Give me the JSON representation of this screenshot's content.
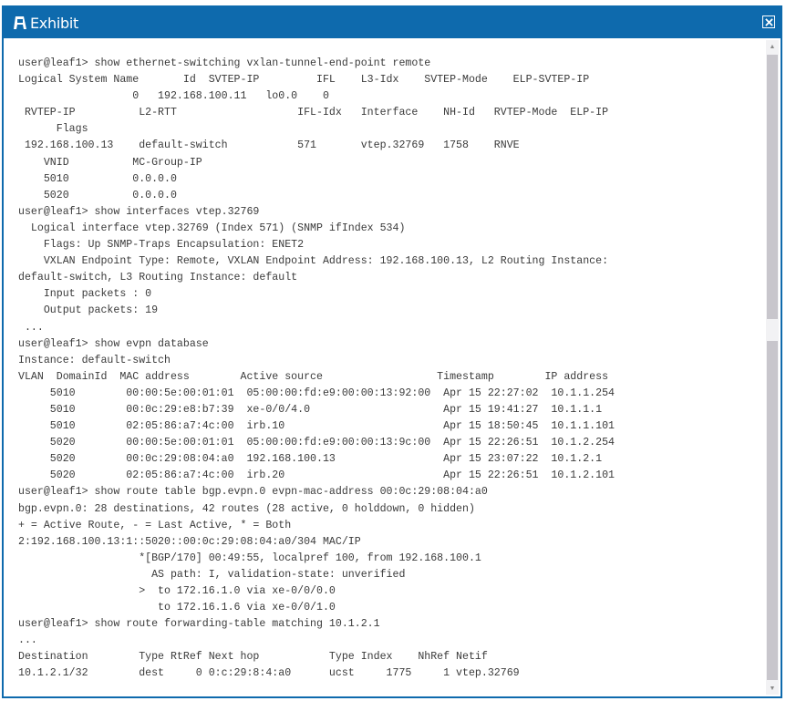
{
  "window": {
    "title": "Exhibit",
    "title_icon": "exhibit-icon",
    "close_icon": "close-icon",
    "brand_color": "#0e6aad"
  },
  "scrollbar": {
    "up_arrow": "▲",
    "down_arrow": "▼"
  },
  "terminal": {
    "lines": [
      "user@leaf1> show ethernet-switching vxlan-tunnel-end-point remote",
      "Logical System Name       Id  SVTEP-IP         IFL    L3-Idx    SVTEP-Mode    ELP-SVTEP-IP",
      "                  0   192.168.100.11   lo0.0    0",
      " RVTEP-IP          L2-RTT                   IFL-Idx   Interface    NH-Id   RVTEP-Mode  ELP-IP",
      "      Flags",
      " 192.168.100.13    default-switch           571       vtep.32769   1758    RNVE",
      "    VNID          MC-Group-IP",
      "    5010          0.0.0.0",
      "    5020          0.0.0.0",
      "user@leaf1> show interfaces vtep.32769",
      "  Logical interface vtep.32769 (Index 571) (SNMP ifIndex 534)",
      "    Flags: Up SNMP-Traps Encapsulation: ENET2",
      "    VXLAN Endpoint Type: Remote, VXLAN Endpoint Address: 192.168.100.13, L2 Routing Instance:",
      "default-switch, L3 Routing Instance: default",
      "    Input packets : 0",
      "    Output packets: 19",
      " ...",
      "user@leaf1> show evpn database",
      "Instance: default-switch",
      "VLAN  DomainId  MAC address        Active source                  Timestamp        IP address",
      "     5010        00:00:5e:00:01:01  05:00:00:fd:e9:00:00:13:92:00  Apr 15 22:27:02  10.1.1.254",
      "     5010        00:0c:29:e8:b7:39  xe-0/0/4.0                     Apr 15 19:41:27  10.1.1.1",
      "     5010        02:05:86:a7:4c:00  irb.10                         Apr 15 18:50:45  10.1.1.101",
      "     5020        00:00:5e:00:01:01  05:00:00:fd:e9:00:00:13:9c:00  Apr 15 22:26:51  10.1.2.254",
      "     5020        00:0c:29:08:04:a0  192.168.100.13                 Apr 15 23:07:22  10.1.2.1",
      "     5020        02:05:86:a7:4c:00  irb.20                         Apr 15 22:26:51  10.1.2.101",
      "user@leaf1> show route table bgp.evpn.0 evpn-mac-address 00:0c:29:08:04:a0",
      "bgp.evpn.0: 28 destinations, 42 routes (28 active, 0 holddown, 0 hidden)",
      "+ = Active Route, - = Last Active, * = Both",
      "2:192.168.100.13:1::5020::00:0c:29:08:04:a0/304 MAC/IP",
      "                   *[BGP/170] 00:49:55, localpref 100, from 192.168.100.1",
      "                     AS path: I, validation-state: unverified",
      "                   >  to 172.16.1.0 via xe-0/0/0.0",
      "                      to 172.16.1.6 via xe-0/0/1.0",
      "user@leaf1> show route forwarding-table matching 10.1.2.1",
      "...",
      "Destination        Type RtRef Next hop           Type Index    NhRef Netif",
      "10.1.2.1/32        dest     0 0:c:29:8:4:a0      ucst     1775     1 vtep.32769"
    ]
  }
}
